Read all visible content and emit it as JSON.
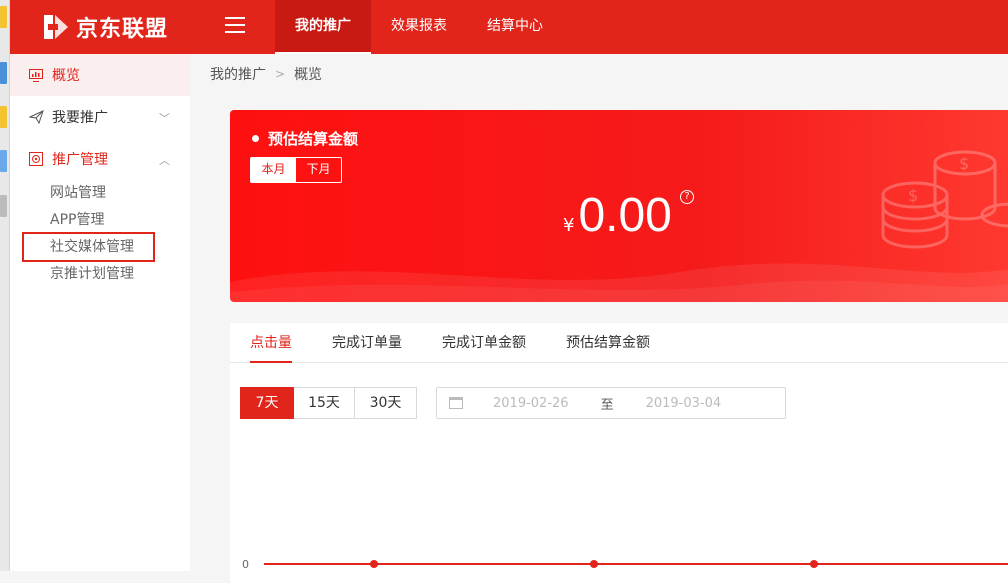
{
  "brand": {
    "name": "京东联盟",
    "accent": "#e1251b"
  },
  "topnav": [
    {
      "label": "我的推广",
      "active": true
    },
    {
      "label": "效果报表",
      "active": false
    },
    {
      "label": "结算中心",
      "active": false
    }
  ],
  "sidebar": {
    "items": [
      {
        "label": "概览",
        "icon": "monitor-chart-icon",
        "active": true
      },
      {
        "label": "我要推广",
        "icon": "paper-plane-icon",
        "expanded": false
      },
      {
        "label": "推广管理",
        "icon": "target-icon",
        "expanded": true,
        "children": [
          "网站管理",
          "APP管理",
          "社交媒体管理",
          "京推计划管理"
        ]
      }
    ]
  },
  "breadcrumb": {
    "root": "我的推广",
    "current": "概览"
  },
  "settlement_card": {
    "title": "预估结算金额",
    "toggle": [
      "本月",
      "下月"
    ],
    "currency": "¥",
    "amount": "0.00",
    "help_icon": "question-circle-icon"
  },
  "metrics_tabs": [
    "点击量",
    "完成订单量",
    "完成订单金额",
    "预估结算金额"
  ],
  "range_buttons": [
    "7天",
    "15天",
    "30天"
  ],
  "date_range": {
    "start": "2019-02-26",
    "separator": "至",
    "end": "2019-03-04"
  },
  "chart_data": {
    "type": "line",
    "y_tick_labels": [
      "0"
    ],
    "series": [
      {
        "values": [
          0,
          0,
          0
        ]
      }
    ]
  }
}
